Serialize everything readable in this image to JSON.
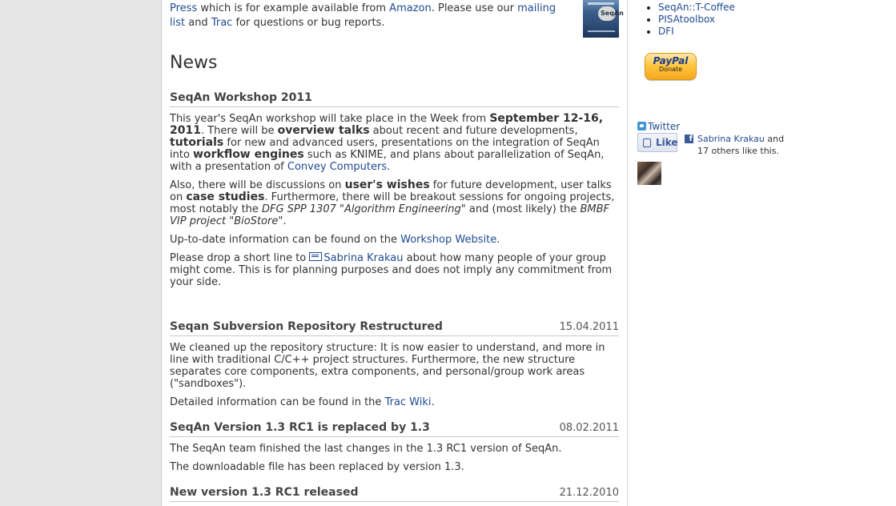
{
  "intro": {
    "line1_link_press": "Press",
    "line1_text": " which is for example available from ",
    "line1_link_amazon": "Amazon",
    "line1_text2": ". Please use our ",
    "line1_link_mailing": "mailing",
    "line2_link_list": "list",
    "line2_text": " and ",
    "line2_link_trac": "Trac",
    "line2_text2": " for questions or bug reports."
  },
  "news_heading": "News",
  "workshop": {
    "title": "SeqAn Workshop 2011",
    "p1": {
      "a": "This year's SeqAn workshop will take place in the Week from ",
      "b": "September 12-16, 2011",
      "c": ". There will be ",
      "d": "overview talks",
      "e": " about recent and future developments, ",
      "f": "tutorials",
      "g": " for new and advanced users, presentations on the integration of SeqAn into ",
      "h": "workflow engines",
      "i": " such as KNIME, and plans about parallelization of SeqAn, with a presentation of ",
      "link": "Convey Computers",
      "j": "."
    },
    "p2": {
      "a": "Also, there will be discussions on ",
      "b": "user's wishes",
      "c": " for future development, user talks on ",
      "d": "case studies",
      "e": ". Furthermore, there will be breakout sessions for ongoing projects, most notably the ",
      "f": "DFG SPP 1307 \"Algorithm Engineering\"",
      "g": " and (most likely) the ",
      "h": "BMBF VIP project \"BioStore\"",
      "i": "."
    },
    "p3": {
      "a": "Up-to-date information can be found on the ",
      "link": "Workshop Website",
      "b": "."
    },
    "p4": {
      "a": "Please drop a short line to ",
      "link": "Sabrina Krakau",
      "b": " about how many people of your group might come. This is for planning purposes and does not imply any commitment from your side."
    }
  },
  "repo": {
    "title": "Seqan Subversion Repository Restructured",
    "date": "15.04.2011",
    "p1": "We cleaned up the repository structure: It is now easier to understand, and more in line with traditional C/C++ project structures. Furthermore, the new structure separates core components, extra components, and personal/group work areas (\"sandboxes\").",
    "p2a": "Detailed information can be found in the ",
    "p2link": "Trac Wiki",
    "p2b": "."
  },
  "v13": {
    "title": "SeqAn Version 1.3 RC1 is replaced by 1.3",
    "date": "08.02.2011",
    "p1": "The SeqAn team finished the last changes in the 1.3 RC1 version of SeqAn.",
    "p2": "The downloadable file has been replaced by version 1.3."
  },
  "rc1": {
    "title": "New version 1.3 RC1 released",
    "date": "21.12.2010"
  },
  "book": {
    "label": "SeqAn"
  },
  "sidebar": {
    "links": [
      "SeqAn::T-Coffee",
      "PISAtoolbox",
      "DFI"
    ],
    "paypal_logo": "PayPal",
    "paypal_donate": "Donate",
    "twitter": "Twitter",
    "like_label": "Like",
    "fb_name": "Sabrina Krakau",
    "fb_and": " and",
    "fb_others": "17 others like this."
  },
  "colors": {
    "link": "#1f4a92",
    "text": "#333333",
    "paypal": "#ffc439",
    "facebook": "#3b5998",
    "twitter": "#3f96d6"
  }
}
